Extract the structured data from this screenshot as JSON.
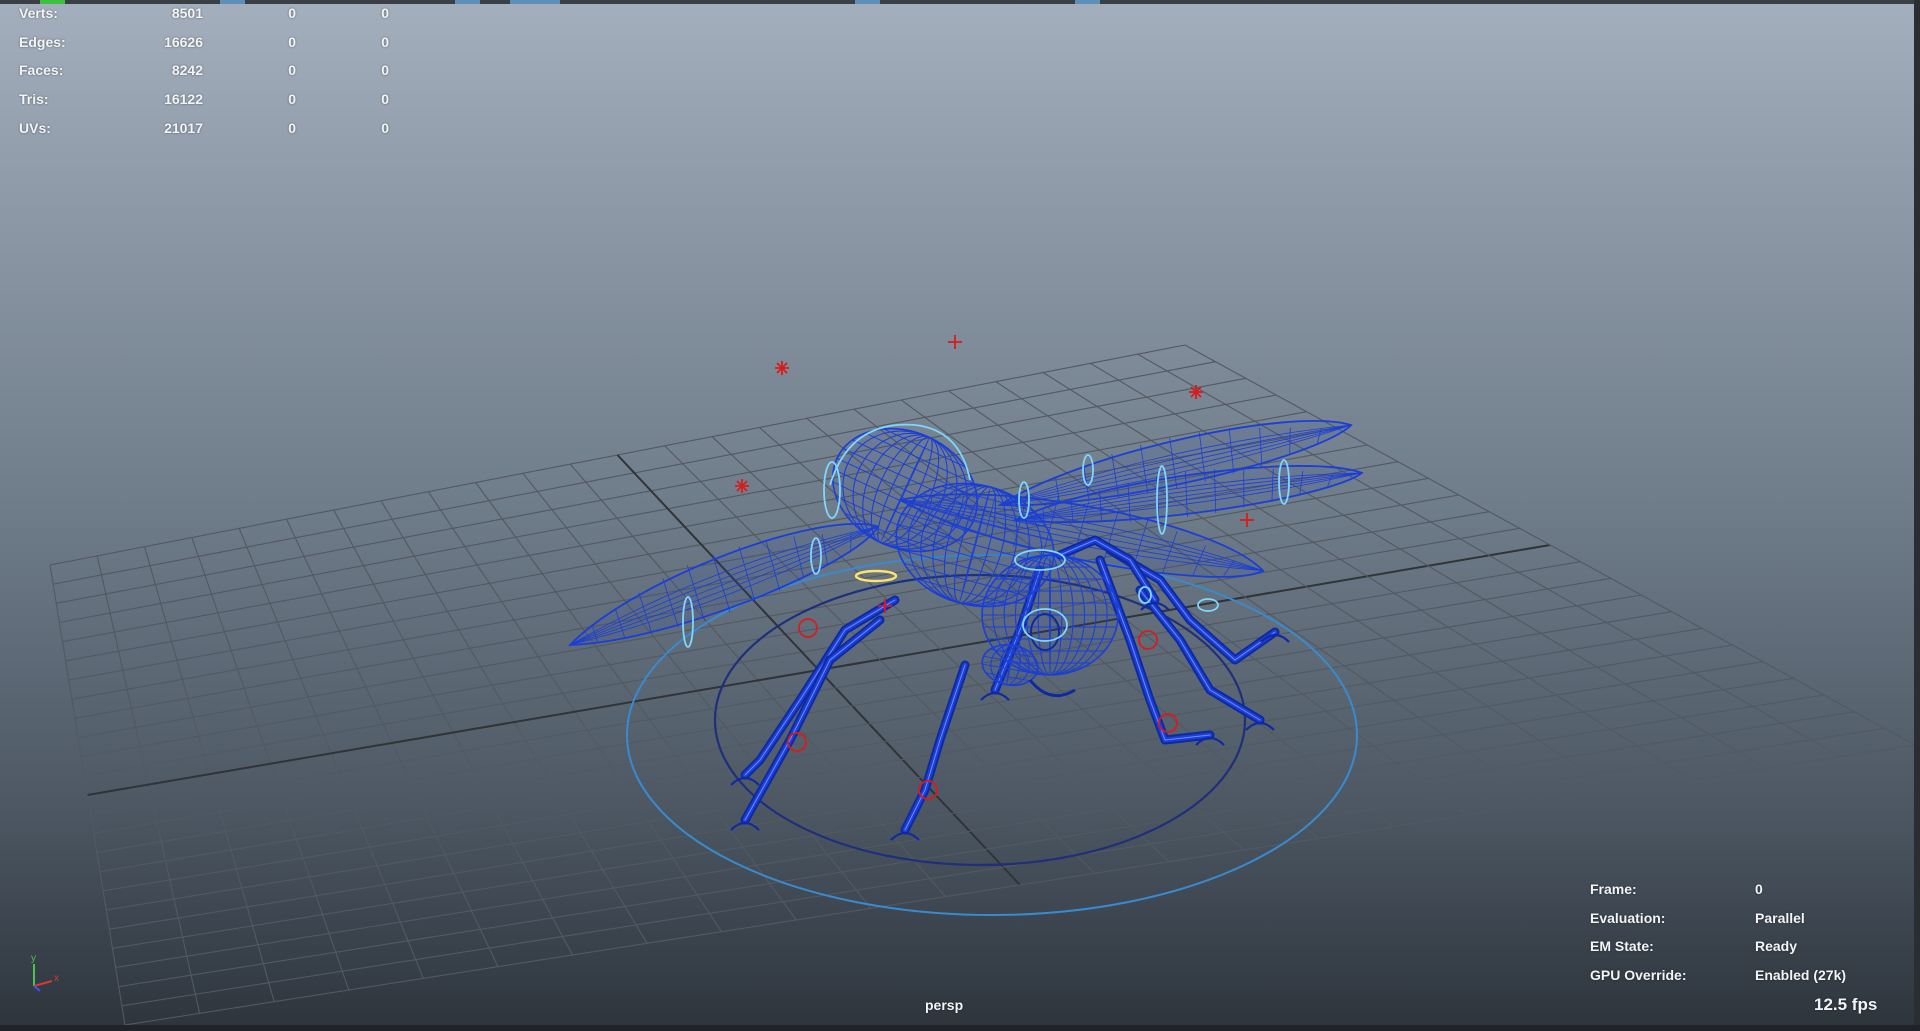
{
  "viewport": {
    "camera_name": "persp",
    "fps": "12.5 fps"
  },
  "poly_count": {
    "rows": [
      {
        "label": "Verts:",
        "v1": "8501",
        "v2": "0",
        "v3": "0"
      },
      {
        "label": "Edges:",
        "v1": "16626",
        "v2": "0",
        "v3": "0"
      },
      {
        "label": "Faces:",
        "v1": "8242",
        "v2": "0",
        "v3": "0"
      },
      {
        "label": "Tris:",
        "v1": "16122",
        "v2": "0",
        "v3": "0"
      },
      {
        "label": "UVs:",
        "v1": "21017",
        "v2": "0",
        "v3": "0"
      }
    ]
  },
  "hud_info": {
    "rows": [
      {
        "label": "Frame:",
        "value": "0"
      },
      {
        "label": "Evaluation:",
        "value": "Parallel"
      },
      {
        "label": "EM State:",
        "value": "Ready"
      },
      {
        "label": "GPU Override:",
        "value": "Enabled (27k)"
      }
    ]
  },
  "axis_gizmo": {
    "x_label": "x",
    "y_label": "y",
    "x_color": "#d9363a",
    "y_color": "#4cc34c",
    "z_color": "#3a59e0"
  },
  "colors": {
    "wireframe": "#1b3fd6",
    "wireframe_dark": "#0f2a9e",
    "controls": "#7fd6ff",
    "selected_control": "#ffe36b",
    "locators": "#d81c1c",
    "grid": "#525961",
    "grid_axis": "#2f3438",
    "ground_circle_inner": "#1f2f7a",
    "ground_circle_outer": "#3a8ad0"
  }
}
